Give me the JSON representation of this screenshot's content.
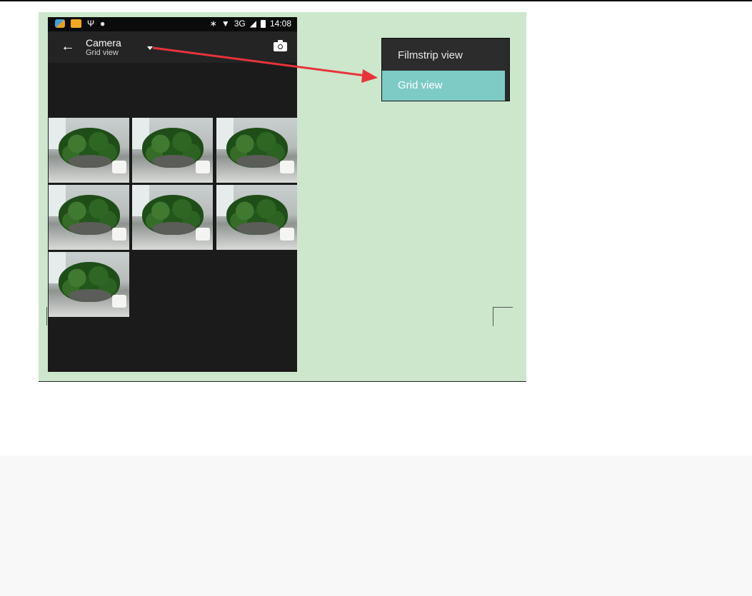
{
  "status_bar": {
    "network": "3G",
    "time": "14:08",
    "icons": [
      "bird-notification-icon",
      "mail-notification-icon",
      "usb-icon",
      "location-icon",
      "bluetooth-icon",
      "wifi-icon",
      "signal-icon",
      "battery-icon"
    ]
  },
  "app_bar": {
    "title": "Camera",
    "subtitle": "Grid view",
    "back_icon": "←",
    "camera_icon": "camera-icon"
  },
  "grid": {
    "photo_count": 7,
    "photos": [
      "plant-photo",
      "plant-photo",
      "plant-photo",
      "plant-photo",
      "plant-photo",
      "plant-photo",
      "plant-photo"
    ]
  },
  "view_menu": {
    "items": [
      {
        "label": "Filmstrip view",
        "selected": false
      },
      {
        "label": "Grid view",
        "selected": true
      }
    ],
    "highlight_color": "#7ecbc6"
  },
  "annotation": {
    "arrow_color": "#e8333a"
  },
  "colors": {
    "figure_background": "#cce7cc",
    "phone_background": "#1b1b1b"
  }
}
